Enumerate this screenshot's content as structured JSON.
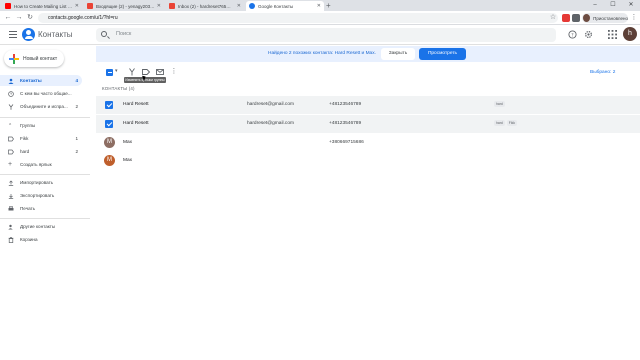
{
  "browser": {
    "tabs": [
      {
        "title": "How to Create Mailing List in G...",
        "favicon_color": "#ff0000",
        "active": false
      },
      {
        "title": "Входящие (2) - yenagy203@gm...",
        "favicon_color": "#ea4335",
        "active": false
      },
      {
        "title": "Inbox (2) - hardreset765@gmai...",
        "favicon_color": "#ea4335",
        "active": false
      },
      {
        "title": "Google Контакты",
        "favicon_color": "#1a73e8",
        "active": true
      }
    ],
    "new_tab_label": "+",
    "url": "contacts.google.com/u/1/?hl=ru",
    "profile_label": "Приостановлено"
  },
  "header": {
    "app_title": "Контакты",
    "search_placeholder": "Поиск",
    "avatar_letter": "h"
  },
  "sidebar": {
    "new_contact_label": "Новый контакт",
    "items": [
      {
        "label": "Контакты",
        "count": "4",
        "active": true,
        "icon": "person-icon"
      },
      {
        "label": "С кем вы часто общае...",
        "count": "",
        "active": false,
        "icon": "history-icon"
      },
      {
        "label": "Объедините и испра...",
        "count": "2",
        "active": false,
        "icon": "merge-icon"
      }
    ],
    "groups_label": "Группы",
    "groups": [
      {
        "label": "Fikk",
        "count": "1"
      },
      {
        "label": "hard",
        "count": "2"
      }
    ],
    "create_label": "Создать ярлык",
    "actions": [
      {
        "label": "Импортировать",
        "icon": "upload-icon"
      },
      {
        "label": "Экспортировать",
        "icon": "download-icon"
      },
      {
        "label": "Печать",
        "icon": "print-icon"
      }
    ],
    "more": [
      {
        "label": "Другие контакты",
        "icon": "person-add-icon"
      },
      {
        "label": "Корзина",
        "icon": "trash-icon"
      }
    ]
  },
  "banner": {
    "message": "Найдено 2 похожих контакта: Hard Resett и Max.",
    "close_label": "Закрыть",
    "view_label": "Просмотреть"
  },
  "toolbar": {
    "tooltip": "Изменить ярлыки группы",
    "selected_label": "Выбрано: 2"
  },
  "list": {
    "header": "КОНТАКТЫ (4)",
    "rows": [
      {
        "name": "Hard Resett",
        "email": "hardreset@gmail.com",
        "phone": "+48123546789",
        "labels": [
          "hard"
        ],
        "selected": true,
        "avatar": ""
      },
      {
        "name": "Hard Resett",
        "email": "hardreset@gmail.com",
        "phone": "+48123546789",
        "labels": [
          "hard",
          "Fikk"
        ],
        "selected": true,
        "avatar": ""
      },
      {
        "name": "Max",
        "email": "",
        "phone": "+380669715686",
        "labels": [],
        "selected": false,
        "avatar": "M",
        "avatar_color": "#8d6e63"
      },
      {
        "name": "Max",
        "email": "",
        "phone": "",
        "labels": [],
        "selected": false,
        "avatar": "M",
        "avatar_color": "#bf5f2c"
      }
    ]
  },
  "colors": {
    "accent": "#1a73e8",
    "active_bg": "#e8f0fe"
  }
}
